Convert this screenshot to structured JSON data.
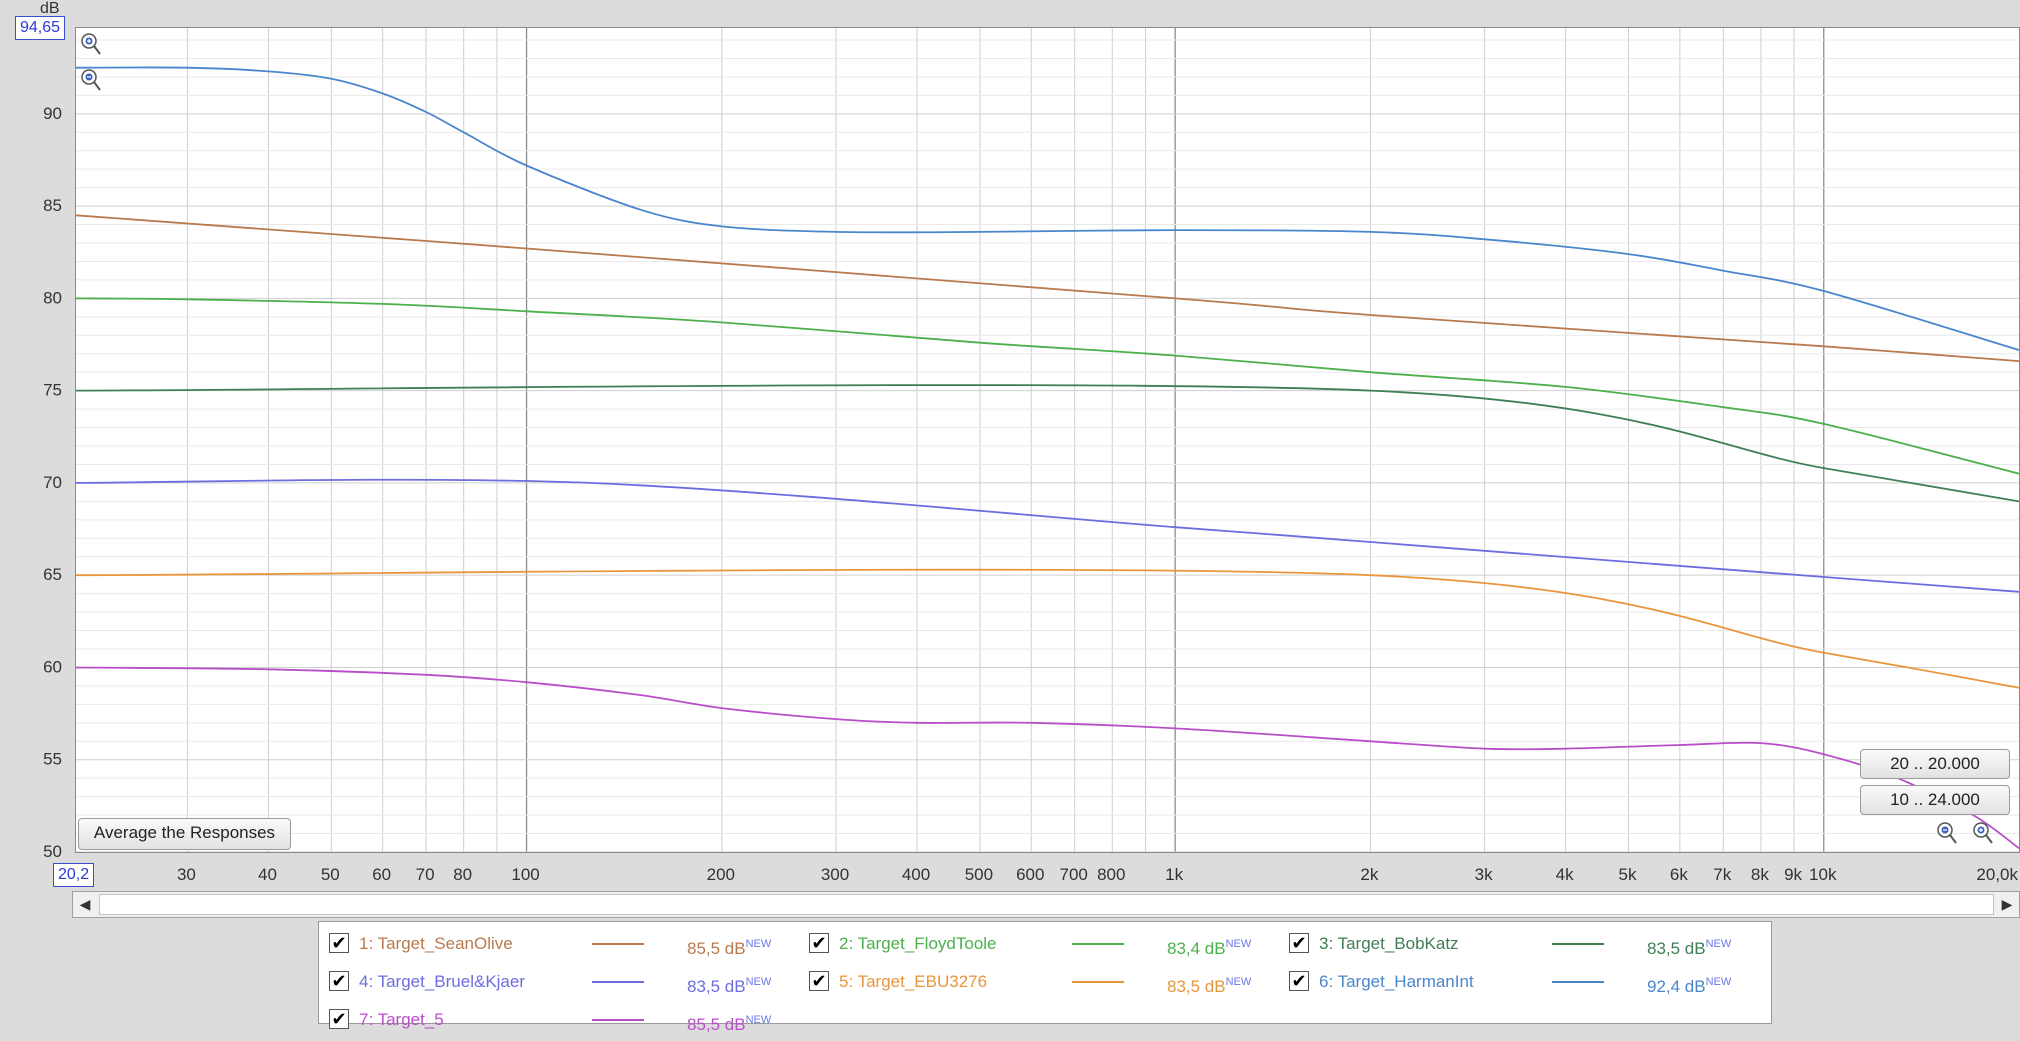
{
  "y_axis_unit": "dB",
  "range_boxes": {
    "ymax": "94,65",
    "xmin": "20,2"
  },
  "buttons": {
    "average": "Average the Responses",
    "range_20k": "20 .. 20.000",
    "range_24k": "10 .. 24.000"
  },
  "chart_data": {
    "type": "line",
    "xscale": "log",
    "xlim": [
      20.2,
      20000
    ],
    "ylim": [
      50,
      94.65
    ],
    "ylabel": "dB",
    "grid": true,
    "y_ticks": [
      50,
      55,
      60,
      65,
      70,
      75,
      80,
      85,
      90
    ],
    "x_ticks": [
      {
        "v": 30,
        "label": "30"
      },
      {
        "v": 40,
        "label": "40"
      },
      {
        "v": 50,
        "label": "50"
      },
      {
        "v": 60,
        "label": "60"
      },
      {
        "v": 70,
        "label": "70"
      },
      {
        "v": 80,
        "label": "80"
      },
      {
        "v": 100,
        "label": "100"
      },
      {
        "v": 200,
        "label": "200"
      },
      {
        "v": 300,
        "label": "300"
      },
      {
        "v": 400,
        "label": "400"
      },
      {
        "v": 500,
        "label": "500"
      },
      {
        "v": 600,
        "label": "600"
      },
      {
        "v": 700,
        "label": "700"
      },
      {
        "v": 800,
        "label": "800"
      },
      {
        "v": 1000,
        "label": "1k"
      },
      {
        "v": 2000,
        "label": "2k"
      },
      {
        "v": 3000,
        "label": "3k"
      },
      {
        "v": 4000,
        "label": "4k"
      },
      {
        "v": 5000,
        "label": "5k"
      },
      {
        "v": 6000,
        "label": "6k"
      },
      {
        "v": 7000,
        "label": "7k"
      },
      {
        "v": 8000,
        "label": "8k"
      },
      {
        "v": 9000,
        "label": "9k"
      },
      {
        "v": 10000,
        "label": "10k"
      },
      {
        "v": 20000,
        "label": "20,0k"
      }
    ],
    "series": [
      {
        "name": "1: Target_SeanOlive",
        "color": "#b87a4e",
        "value": "85,5 dB",
        "points": [
          [
            20.2,
            84.5
          ],
          [
            100,
            82.7
          ],
          [
            1000,
            80.0
          ],
          [
            2000,
            79.1
          ],
          [
            10000,
            77.4
          ],
          [
            20000,
            76.6
          ]
        ]
      },
      {
        "name": "2: Target_FloydToole",
        "color": "#4cb04c",
        "value": "83,4 dB",
        "points": [
          [
            20.2,
            80.0
          ],
          [
            30,
            79.95
          ],
          [
            60,
            79.7
          ],
          [
            100,
            79.3
          ],
          [
            200,
            78.7
          ],
          [
            500,
            77.6
          ],
          [
            1000,
            76.9
          ],
          [
            2000,
            76.0
          ],
          [
            4000,
            75.2
          ],
          [
            7000,
            74.1
          ],
          [
            10000,
            73.2
          ],
          [
            20000,
            70.5
          ]
        ]
      },
      {
        "name": "3: Target_BobKatz",
        "color": "#3f7f55",
        "value": "83,5 dB",
        "points": [
          [
            20.2,
            75.0
          ],
          [
            2000,
            75.0
          ],
          [
            10000,
            70.8
          ],
          [
            20000,
            69.0
          ]
        ]
      },
      {
        "name": "4: Target_Bruel&Kjaer",
        "color": "#6d6de0",
        "value": "83,5 dB",
        "points": [
          [
            20.2,
            70.0
          ],
          [
            125,
            70.0
          ],
          [
            1000,
            67.6
          ],
          [
            2000,
            66.8
          ],
          [
            10000,
            64.9
          ],
          [
            20000,
            64.1
          ]
        ]
      },
      {
        "name": "5: Target_EBU3276",
        "color": "#e8963c",
        "value": "83,5 dB",
        "points": [
          [
            20.2,
            65.0
          ],
          [
            2000,
            65.0
          ],
          [
            10000,
            60.8
          ],
          [
            20000,
            58.9
          ]
        ]
      },
      {
        "name": "6: Target_HarmanInt",
        "color": "#4a86cc",
        "value": "92,4 dB",
        "points": [
          [
            20.2,
            92.5
          ],
          [
            30,
            92.5
          ],
          [
            40,
            92.3
          ],
          [
            50,
            91.9
          ],
          [
            60,
            91.1
          ],
          [
            70,
            90.1
          ],
          [
            80,
            89.0
          ],
          [
            100,
            87.2
          ],
          [
            150,
            84.8
          ],
          [
            200,
            83.9
          ],
          [
            300,
            83.6
          ],
          [
            500,
            83.6
          ],
          [
            1000,
            83.7
          ],
          [
            2000,
            83.6
          ],
          [
            3000,
            83.2
          ],
          [
            5000,
            82.4
          ],
          [
            7000,
            81.5
          ],
          [
            10000,
            80.4
          ],
          [
            20000,
            77.2
          ]
        ]
      },
      {
        "name": "7: Target_5",
        "color": "#b84fc8",
        "value": "85,5 dB",
        "points": [
          [
            20.2,
            60.0
          ],
          [
            40,
            59.9
          ],
          [
            70,
            59.6
          ],
          [
            100,
            59.2
          ],
          [
            150,
            58.5
          ],
          [
            200,
            57.8
          ],
          [
            300,
            57.2
          ],
          [
            400,
            57.0
          ],
          [
            600,
            57.0
          ],
          [
            1000,
            56.7
          ],
          [
            2000,
            56.0
          ],
          [
            3000,
            55.6
          ],
          [
            4000,
            55.6
          ],
          [
            6000,
            55.8
          ],
          [
            8000,
            55.9
          ],
          [
            10000,
            55.3
          ],
          [
            13000,
            54.0
          ],
          [
            17000,
            52.0
          ],
          [
            20000,
            50.2
          ]
        ]
      }
    ]
  },
  "legend_badge": "NEW"
}
